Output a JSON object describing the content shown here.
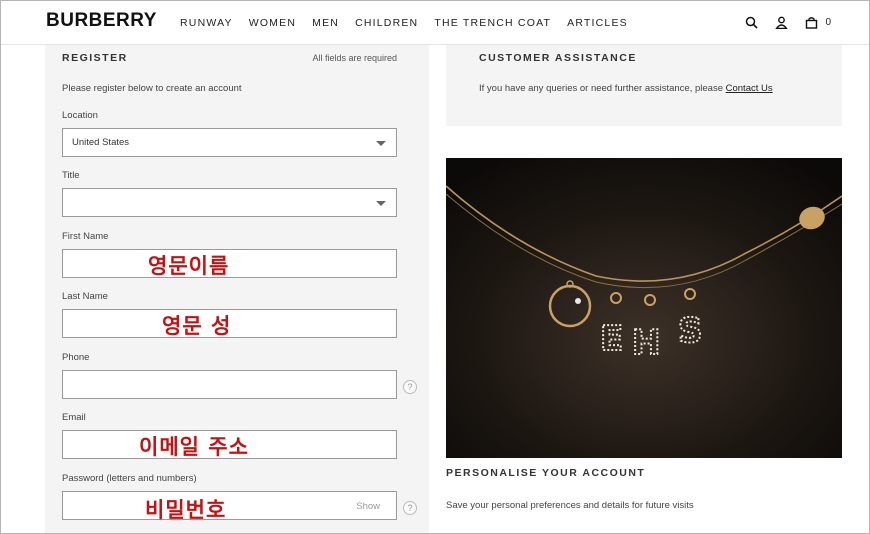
{
  "header": {
    "logo": "BURBERRY",
    "nav": [
      "RUNWAY",
      "WOMEN",
      "MEN",
      "CHILDREN",
      "THE TRENCH COAT",
      "ARTICLES"
    ],
    "icons": [
      "search-icon",
      "account-icon",
      "bag-icon"
    ],
    "bag_count": "0"
  },
  "register": {
    "title": "REGISTER",
    "required_note": "All fields are required",
    "intro": "Please register below to create an account",
    "location": {
      "label": "Location",
      "value": "United States"
    },
    "title_field": {
      "label": "Title",
      "value": ""
    },
    "first_name": {
      "label": "First Name",
      "overlay": "영문이름"
    },
    "last_name": {
      "label": "Last Name",
      "overlay": "영문 성"
    },
    "phone": {
      "label": "Phone",
      "help": "?"
    },
    "email": {
      "label": "Email",
      "overlay": "이메일 주소"
    },
    "password": {
      "label": "Password (letters and numbers)",
      "overlay": "비밀번호",
      "show": "Show",
      "help": "?"
    }
  },
  "assistance": {
    "title": "CUSTOMER ASSISTANCE",
    "text": "If you have any queries or need further assistance, please ",
    "link": "Contact Us"
  },
  "personalise": {
    "title": "PERSONALISE YOUR ACCOUNT",
    "text": "Save your personal preferences and details for future visits",
    "charm_letters": [
      "E",
      "H",
      "S"
    ]
  },
  "colors": {
    "overlay_text": "#c41212",
    "panel_bg": "#f4f4f4"
  }
}
